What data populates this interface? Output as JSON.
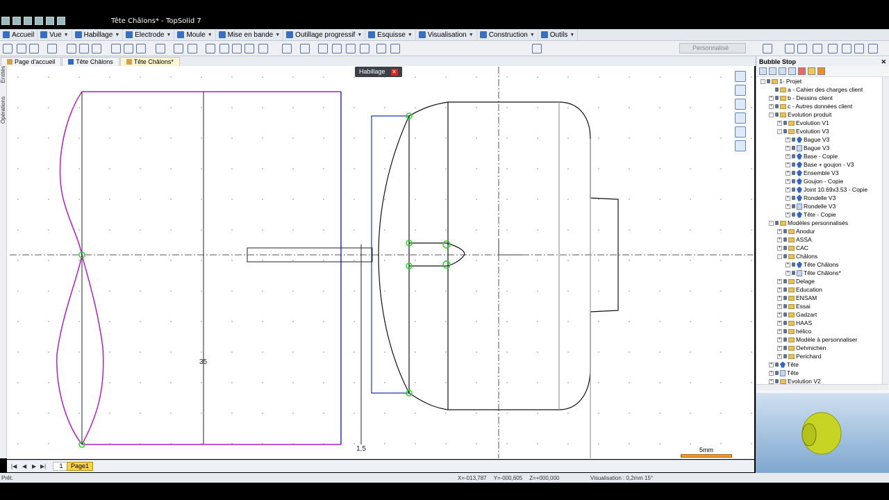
{
  "window": {
    "title": "Tête Châlons* - TopSolid 7"
  },
  "menu": {
    "items": [
      {
        "label": "Accueil"
      },
      {
        "label": "Vue"
      },
      {
        "label": "Habillage"
      },
      {
        "label": "Electrode"
      },
      {
        "label": "Moule"
      },
      {
        "label": "Mise en bande"
      },
      {
        "label": "Outillage progressif"
      },
      {
        "label": "Esquisse"
      },
      {
        "label": "Visualisation"
      },
      {
        "label": "Construction"
      },
      {
        "label": "Outils"
      }
    ]
  },
  "toolbar": {
    "style_combo": "Personnalisé"
  },
  "tabs": [
    {
      "label": "Page d'accueil"
    },
    {
      "label": "Tête Châlons"
    },
    {
      "label": "Tête Châlons*"
    }
  ],
  "left_strip": {
    "entities": "Entités",
    "operations": "Opérations"
  },
  "canvas": {
    "pill_label": "Habillage",
    "dim_35": "35",
    "dim_15": "1,5"
  },
  "scale": {
    "label": "5mm"
  },
  "pages": {
    "number": "1",
    "tab": "Page1"
  },
  "status": {
    "text": "Prêt.",
    "x": "X=-013,787",
    "y": "Y=-000,605",
    "z": "Z=+000,000",
    "visualisation": "Visualisation : 0,2mm 15°"
  },
  "panel": {
    "title": "Bubble Stop",
    "tree": [
      {
        "label": "1- Projet",
        "depth": 0,
        "kind": "folder",
        "exp": "-"
      },
      {
        "label": "a - Cahier des charges client",
        "depth": 1,
        "kind": "folder",
        "exp": ""
      },
      {
        "label": "b - Dessins client",
        "depth": 1,
        "kind": "folder",
        "exp": "+"
      },
      {
        "label": "c - Autres données client",
        "depth": 1,
        "kind": "folder",
        "exp": "+"
      },
      {
        "label": "Evolution produit",
        "depth": 1,
        "kind": "folder",
        "exp": "-"
      },
      {
        "label": "Evolution V1",
        "depth": 2,
        "kind": "folder",
        "exp": "+"
      },
      {
        "label": "Evolution V3",
        "depth": 2,
        "kind": "folder",
        "exp": "-"
      },
      {
        "label": "Bague V3",
        "depth": 3,
        "kind": "part",
        "exp": "+"
      },
      {
        "label": "Bague V3",
        "depth": 3,
        "kind": "doc",
        "exp": "+"
      },
      {
        "label": "Base - Copie",
        "depth": 3,
        "kind": "part",
        "exp": "+"
      },
      {
        "label": "Base + goujon - V3",
        "depth": 3,
        "kind": "part",
        "exp": "+"
      },
      {
        "label": "Ensemble V3",
        "depth": 3,
        "kind": "part",
        "exp": "+"
      },
      {
        "label": "Goujon - Copie",
        "depth": 3,
        "kind": "part",
        "exp": "+"
      },
      {
        "label": "Joint 10.69x3.53 - Copie",
        "depth": 3,
        "kind": "part",
        "exp": "+"
      },
      {
        "label": "Rondelle V3",
        "depth": 3,
        "kind": "part",
        "exp": "+"
      },
      {
        "label": "Rondelle V3",
        "depth": 3,
        "kind": "doc",
        "exp": "+"
      },
      {
        "label": "Tête - Copie",
        "depth": 3,
        "kind": "part",
        "exp": "+"
      },
      {
        "label": "Modèles personnalisés",
        "depth": 1,
        "kind": "folder",
        "exp": "-"
      },
      {
        "label": "Anodur",
        "depth": 2,
        "kind": "folder",
        "exp": "+"
      },
      {
        "label": "ASSA",
        "depth": 2,
        "kind": "folder",
        "exp": "+"
      },
      {
        "label": "CAC",
        "depth": 2,
        "kind": "folder",
        "exp": "+"
      },
      {
        "label": "Châlons",
        "depth": 2,
        "kind": "folder",
        "exp": "-"
      },
      {
        "label": "Tête Châlons",
        "depth": 3,
        "kind": "part",
        "exp": "+"
      },
      {
        "label": "Tête Châlons*",
        "depth": 3,
        "kind": "doc",
        "exp": "+"
      },
      {
        "label": "Delage",
        "depth": 2,
        "kind": "folder",
        "exp": "+"
      },
      {
        "label": "Education",
        "depth": 2,
        "kind": "folder",
        "exp": "+"
      },
      {
        "label": "ENSAM",
        "depth": 2,
        "kind": "folder",
        "exp": "+"
      },
      {
        "label": "Essai",
        "depth": 2,
        "kind": "folder",
        "exp": "+"
      },
      {
        "label": "Gadzart",
        "depth": 2,
        "kind": "folder",
        "exp": "+"
      },
      {
        "label": "HAAS",
        "depth": 2,
        "kind": "folder",
        "exp": "+"
      },
      {
        "label": "hélico",
        "depth": 2,
        "kind": "folder",
        "exp": "+"
      },
      {
        "label": "Modèle à personnaliser",
        "depth": 2,
        "kind": "folder",
        "exp": "+"
      },
      {
        "label": "Oehmichen",
        "depth": 2,
        "kind": "folder",
        "exp": "+"
      },
      {
        "label": "Perichard",
        "depth": 2,
        "kind": "folder",
        "exp": "+"
      },
      {
        "label": "Tête",
        "depth": 1,
        "kind": "part",
        "exp": "+"
      },
      {
        "label": "Tête",
        "depth": 1,
        "kind": "doc",
        "exp": "+"
      },
      {
        "label": "Evolution V2",
        "depth": 1,
        "kind": "folder",
        "exp": "+"
      }
    ]
  },
  "colors": {
    "sketch": "#b020c0",
    "blue": "#2030c0",
    "accent": "#f5d34c",
    "point": "#22dd22"
  }
}
